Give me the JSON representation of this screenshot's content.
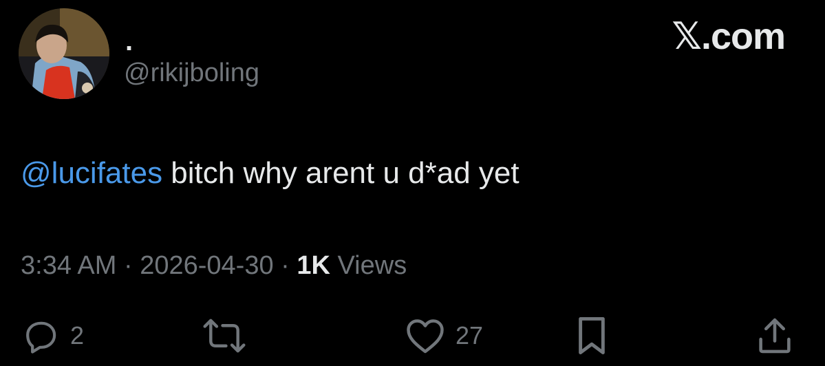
{
  "author": {
    "display_name": ".",
    "handle": "@rikijboling",
    "avatar_icon": "profile-photo"
  },
  "brand": {
    "label": "𝕏.com"
  },
  "tweet": {
    "mention": "@lucifates",
    "text": " bitch why arent u d*ad yet"
  },
  "meta": {
    "time": "3:34 AM",
    "separator_1": " · ",
    "date": "2026-04-30",
    "separator_2": " · ",
    "views_count": "1K",
    "views_label": " Views"
  },
  "actions": {
    "reply": {
      "icon": "reply-icon",
      "count": "2"
    },
    "retweet": {
      "icon": "retweet-icon"
    },
    "like": {
      "icon": "heart-icon",
      "count": "27"
    },
    "bookmark": {
      "icon": "bookmark-icon"
    },
    "share": {
      "icon": "share-icon"
    }
  },
  "colors": {
    "background": "#000000",
    "primary_text": "#e7e9ea",
    "secondary_text": "#71767b",
    "link": "#4a99e9"
  }
}
